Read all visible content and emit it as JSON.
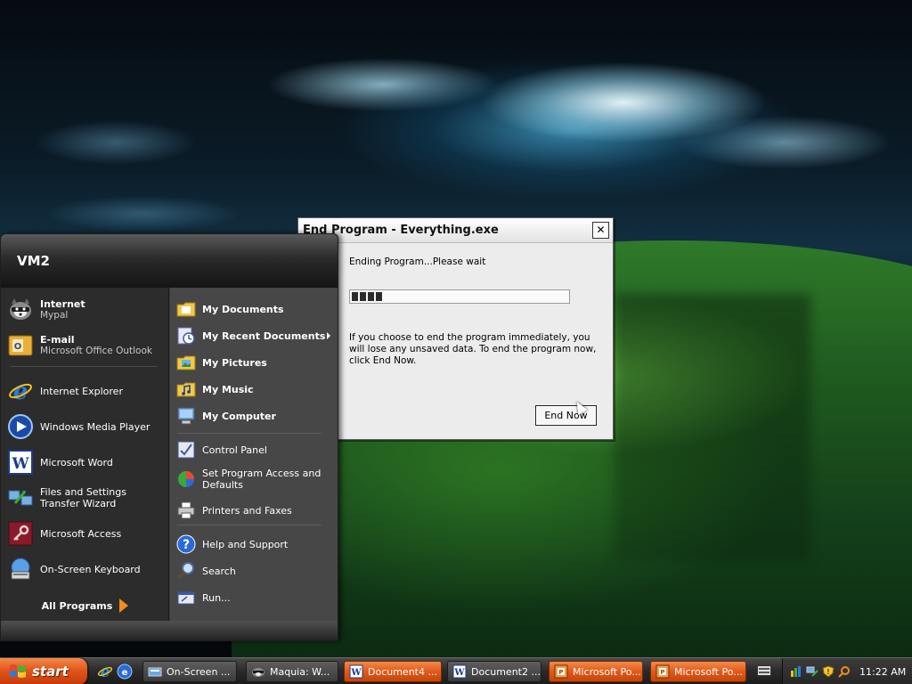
{
  "dialog": {
    "title": "End Program - Everything.exe",
    "close_glyph": "✕",
    "status": "Ending Program...Please wait",
    "progress_fraction": 0.15,
    "warning": "If you choose to end the program immediately, you will lose any unsaved data. To end the program now, click End Now.",
    "end_now_label": "End Now"
  },
  "start_menu": {
    "username": "VM2",
    "pinned": [
      {
        "title": "Internet",
        "subtitle": "Mypal",
        "icon": "raccoon-browser-icon"
      },
      {
        "title": "E-mail",
        "subtitle": "Microsoft Office Outlook",
        "icon": "outlook-icon"
      }
    ],
    "recent": [
      {
        "label": "Internet Explorer",
        "icon": "internet-explorer-icon"
      },
      {
        "label": "Windows Media Player",
        "icon": "media-player-icon"
      },
      {
        "label": "Microsoft Word",
        "icon": "word-icon"
      },
      {
        "label": "Files and Settings Transfer Wizard",
        "icon": "transfer-wizard-icon"
      },
      {
        "label": "Microsoft Access",
        "icon": "access-icon"
      },
      {
        "label": "On-Screen Keyboard",
        "icon": "keyboard-icon"
      }
    ],
    "all_programs": "All Programs",
    "places": [
      {
        "label": "My Documents",
        "icon": "folder-documents-icon"
      },
      {
        "label": "My Recent Documents",
        "icon": "recent-documents-icon"
      },
      {
        "label": "My Pictures",
        "icon": "folder-pictures-icon"
      },
      {
        "label": "My Music",
        "icon": "folder-music-icon"
      },
      {
        "label": "My Computer",
        "icon": "computer-icon"
      }
    ],
    "system": [
      {
        "label": "Control Panel",
        "icon": "control-panel-icon"
      },
      {
        "label": "Set Program Access and Defaults",
        "icon": "program-defaults-icon"
      },
      {
        "label": "Printers and Faxes",
        "icon": "printer-icon"
      }
    ],
    "help": [
      {
        "label": "Help and Support",
        "icon": "help-icon"
      },
      {
        "label": "Search",
        "icon": "search-icon"
      },
      {
        "label": "Run...",
        "icon": "run-icon"
      }
    ]
  },
  "taskbar": {
    "start_label": "start",
    "tasks": [
      {
        "label": "On-Screen ...",
        "icon": "keyboard-icon",
        "active": false
      },
      {
        "label": "Maquia: W...",
        "icon": "raccoon-browser-icon",
        "active": false
      },
      {
        "label": "Document4 ...",
        "icon": "word-icon",
        "active": true
      },
      {
        "label": "Document2 ...",
        "icon": "word-icon",
        "active": false
      },
      {
        "label": "Microsoft Po...",
        "icon": "powerpoint-icon",
        "active": true
      },
      {
        "label": "Microsoft Po...",
        "icon": "powerpoint-icon",
        "active": true
      }
    ],
    "clock": "11:22 AM"
  },
  "colors": {
    "start_orange": "#e2561a",
    "menu_dark": "#2c2c2c",
    "menu_panel": "#474747",
    "dialog_bg": "#ececec"
  }
}
